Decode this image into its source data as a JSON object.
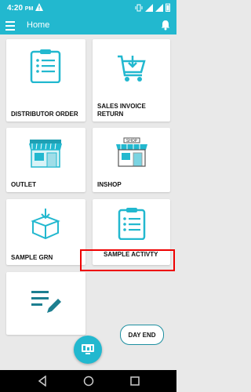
{
  "status_bar": {
    "time": "4:20",
    "time_suffix": "PM"
  },
  "app_bar": {
    "title": "Home"
  },
  "cards": {
    "distributor_order": "DISTRIBUTOR ORDER",
    "sales_invoice_return_1": "SALES INVOICE",
    "sales_invoice_return_2": "RETURN",
    "outlet": "OUTLET",
    "inshop": "INSHOP",
    "sample_grn": "SAMPLE GRN",
    "sample_activity": "SAMPLE ACTIVTY"
  },
  "shop_sign": "SHOP",
  "day_end": "DAY END",
  "colors": {
    "accent": "#22b8cf",
    "highlight": "#ee0000"
  }
}
